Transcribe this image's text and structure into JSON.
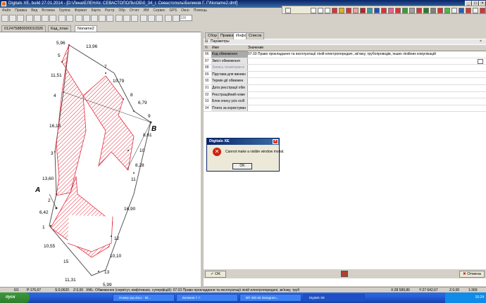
{
  "window": {
    "title": "Digitals XE, build 27.01.2014 - [D:\\Лена\\ЕЛЕНА\\г. СЕВАСТОПОЛЬ\\ОБ\\0_34_г. Севастополь\\Беликов Г. Г\\Noname2.dmf]",
    "min": "_",
    "max": "□",
    "close": "×"
  },
  "menu": [
    "Файл",
    "Правка",
    "Вид",
    "Вставка",
    "Группа",
    "Формат",
    "Карта",
    "Растр",
    "Обр",
    "Отчет",
    "ИМ",
    "Сервис",
    "GPS",
    "Окно",
    "Помощь"
  ],
  "toolbar": {
    "zoom": "100"
  },
  "doc_tabs": [
    "012475880000010326",
    "Кад_план",
    "Noname2"
  ],
  "drawing": {
    "labels": {
      "p5": "5",
      "p4": "4",
      "p3": "3",
      "p2": "2",
      "p1": "1",
      "p15": "15",
      "p13": "13",
      "p12": "12",
      "p11": "11",
      "p10": "10",
      "p9": "9",
      "p8": "8",
      "p7": "7",
      "d596": "5,96",
      "d1396": "13,96",
      "d1151": "11,51",
      "d1079": "10,79",
      "d679": "6,79",
      "d861": "8,61",
      "d1618": "16,18",
      "d828": "8,28",
      "d1360": "13,60",
      "d642": "6,42",
      "d1690": "16,90",
      "d1055": "10,55",
      "d1010": "10,10",
      "d1131": "11,31",
      "d599": "5,99",
      "A": "A",
      "B": "B"
    }
  },
  "panel": {
    "tabs": [
      "Сбор",
      "Правка",
      "Инфо",
      "Список"
    ],
    "params_label": "Параметры",
    "header": {
      "n": "N",
      "name": "Имя",
      "value": "Значение"
    },
    "rows": [
      {
        "n": "86",
        "name": "Код обмеження",
        "value": "07.03 Право прокладання та експлуатації ліній електропередачі, зв'язку, трубопроводів, інших лінійних комунікацій"
      },
      {
        "n": "87",
        "name": "Зміст обмеження",
        "value": ""
      },
      {
        "n": "88",
        "name": "Запись геометрии в",
        "value": ""
      },
      {
        "n": "89",
        "name": "Підстава для виникн",
        "value": ""
      },
      {
        "n": "90",
        "name": "Термін дії обмежен",
        "value": ""
      },
      {
        "n": "91",
        "name": "Дата реєстрації обм",
        "value": ""
      },
      {
        "n": "92",
        "name": "Реєстраційний номе",
        "value": ""
      },
      {
        "n": "93",
        "name": "Блок опису усіх осіб",
        "value": ""
      },
      {
        "n": "94",
        "name": "Плата за користуван",
        "value": ""
      }
    ],
    "ok_button": "OK",
    "cancel_button": "Отмена"
  },
  "dialog": {
    "title": "Digitals XE",
    "message": "Cannot make a visible window modal.",
    "ok": "OK",
    "icon": "error-icon"
  },
  "status": {
    "item1": "6/1",
    "item2": "P:176,67",
    "item3": "S:0,0620",
    "item4": "Z:0,00",
    "info": "XML: Обмеження (сервітут, емфітевзис, суперфіцій): 07.03 Право прокладання та експлуатації ліній електропередачі, зв'язку, труб",
    "x": "X:28 589,86",
    "y": "Y:27 642,67",
    "z": "Z:0,00",
    "scale": "1:369"
  },
  "taskbar": {
    "start": "пуск",
    "tasks": [
      "Номер укр.docx - Mi...",
      "Беликов Г. Г.",
      "ВП 330 кВ Западнен...",
      "Digitals XE"
    ],
    "clock": "16:24"
  },
  "colors": {
    "hatch": "#e03040",
    "titlebar": "#0a246a"
  }
}
